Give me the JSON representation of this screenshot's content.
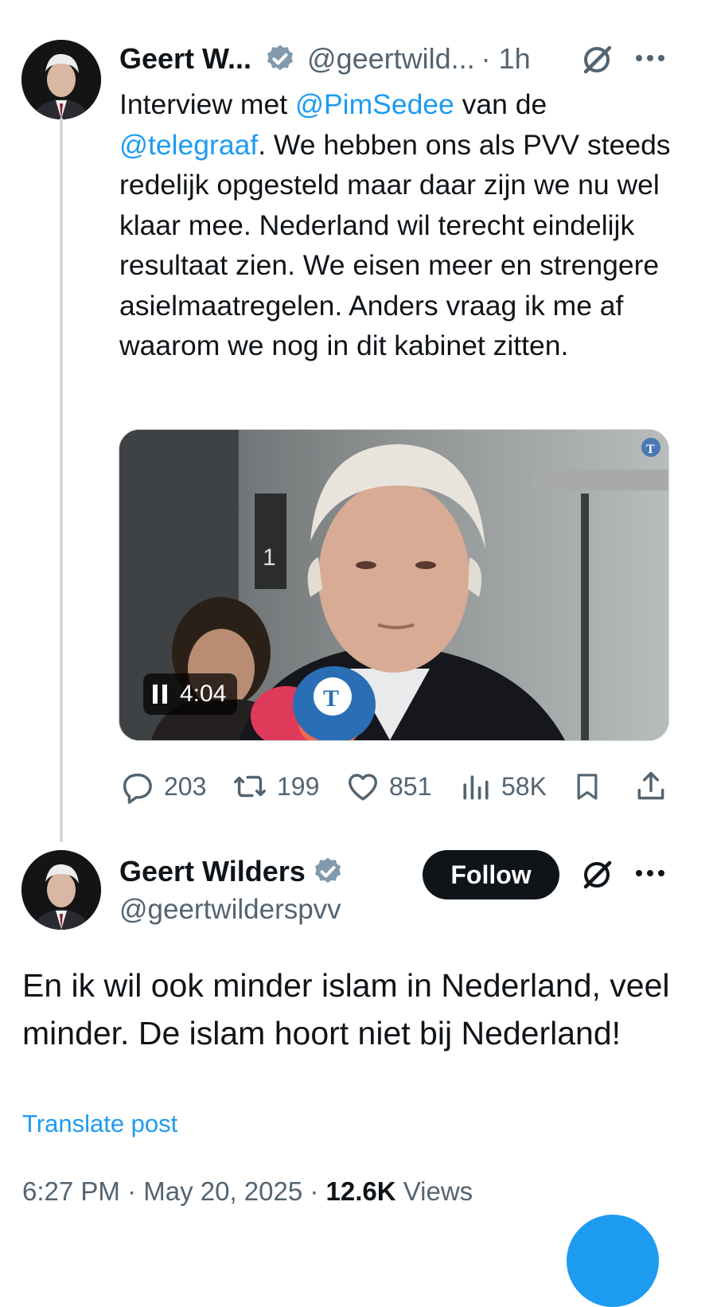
{
  "tweet1": {
    "author_name": "Geert W...",
    "handle": "@geertwild...",
    "time": "· 1h",
    "text_parts": {
      "p1": "Interview met ",
      "mention1": "@PimSedee",
      "p2": " van de ",
      "mention2": "@telegraaf",
      "p3": ". We hebben ons als PVV steeds redelijk opgesteld maar daar zijn we nu wel klaar mee. Nederland wil terecht eindelijk resultaat zien. We eisen meer en strengere asielmaatregelen. Anders vraag ik me af waarom we nog in dit kabinet zitten."
    },
    "video": {
      "duration": "4:04",
      "state": "playing"
    },
    "stats": {
      "replies": "203",
      "reposts": "199",
      "likes": "851",
      "views": "58K"
    }
  },
  "tweet2": {
    "author_name": "Geert Wilders",
    "handle": "@geertwilderspvv",
    "follow_label": "Follow",
    "text": "En ik wil ook minder islam in Nederland, veel minder. De islam hoort niet bij Nederland!",
    "translate_label": "Translate post",
    "timestamp": "6:27 PM · May 20, 2025 · ",
    "views_count": "12.6K",
    "views_label": " Views"
  },
  "colors": {
    "accent": "#1d9bf0",
    "text": "#0f1419",
    "muted": "#536471",
    "verified": "#829aab"
  },
  "icons": [
    "verified-badge-icon",
    "grok-icon",
    "more-icon",
    "reply-icon",
    "repost-icon",
    "like-icon",
    "views-icon",
    "bookmark-icon",
    "share-icon",
    "pause-icon"
  ]
}
